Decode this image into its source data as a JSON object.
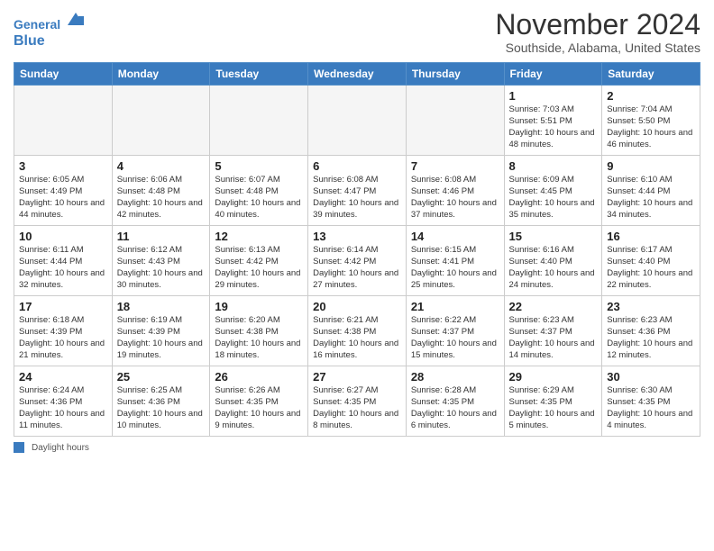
{
  "header": {
    "logo_line1": "General",
    "logo_line2": "Blue",
    "title": "November 2024",
    "subtitle": "Southside, Alabama, United States"
  },
  "days_of_week": [
    "Sunday",
    "Monday",
    "Tuesday",
    "Wednesday",
    "Thursday",
    "Friday",
    "Saturday"
  ],
  "weeks": [
    [
      {
        "day": "",
        "info": ""
      },
      {
        "day": "",
        "info": ""
      },
      {
        "day": "",
        "info": ""
      },
      {
        "day": "",
        "info": ""
      },
      {
        "day": "",
        "info": ""
      },
      {
        "day": "1",
        "info": "Sunrise: 7:03 AM\nSunset: 5:51 PM\nDaylight: 10 hours and 48 minutes."
      },
      {
        "day": "2",
        "info": "Sunrise: 7:04 AM\nSunset: 5:50 PM\nDaylight: 10 hours and 46 minutes."
      }
    ],
    [
      {
        "day": "3",
        "info": "Sunrise: 6:05 AM\nSunset: 4:49 PM\nDaylight: 10 hours and 44 minutes."
      },
      {
        "day": "4",
        "info": "Sunrise: 6:06 AM\nSunset: 4:48 PM\nDaylight: 10 hours and 42 minutes."
      },
      {
        "day": "5",
        "info": "Sunrise: 6:07 AM\nSunset: 4:48 PM\nDaylight: 10 hours and 40 minutes."
      },
      {
        "day": "6",
        "info": "Sunrise: 6:08 AM\nSunset: 4:47 PM\nDaylight: 10 hours and 39 minutes."
      },
      {
        "day": "7",
        "info": "Sunrise: 6:08 AM\nSunset: 4:46 PM\nDaylight: 10 hours and 37 minutes."
      },
      {
        "day": "8",
        "info": "Sunrise: 6:09 AM\nSunset: 4:45 PM\nDaylight: 10 hours and 35 minutes."
      },
      {
        "day": "9",
        "info": "Sunrise: 6:10 AM\nSunset: 4:44 PM\nDaylight: 10 hours and 34 minutes."
      }
    ],
    [
      {
        "day": "10",
        "info": "Sunrise: 6:11 AM\nSunset: 4:44 PM\nDaylight: 10 hours and 32 minutes."
      },
      {
        "day": "11",
        "info": "Sunrise: 6:12 AM\nSunset: 4:43 PM\nDaylight: 10 hours and 30 minutes."
      },
      {
        "day": "12",
        "info": "Sunrise: 6:13 AM\nSunset: 4:42 PM\nDaylight: 10 hours and 29 minutes."
      },
      {
        "day": "13",
        "info": "Sunrise: 6:14 AM\nSunset: 4:42 PM\nDaylight: 10 hours and 27 minutes."
      },
      {
        "day": "14",
        "info": "Sunrise: 6:15 AM\nSunset: 4:41 PM\nDaylight: 10 hours and 25 minutes."
      },
      {
        "day": "15",
        "info": "Sunrise: 6:16 AM\nSunset: 4:40 PM\nDaylight: 10 hours and 24 minutes."
      },
      {
        "day": "16",
        "info": "Sunrise: 6:17 AM\nSunset: 4:40 PM\nDaylight: 10 hours and 22 minutes."
      }
    ],
    [
      {
        "day": "17",
        "info": "Sunrise: 6:18 AM\nSunset: 4:39 PM\nDaylight: 10 hours and 21 minutes."
      },
      {
        "day": "18",
        "info": "Sunrise: 6:19 AM\nSunset: 4:39 PM\nDaylight: 10 hours and 19 minutes."
      },
      {
        "day": "19",
        "info": "Sunrise: 6:20 AM\nSunset: 4:38 PM\nDaylight: 10 hours and 18 minutes."
      },
      {
        "day": "20",
        "info": "Sunrise: 6:21 AM\nSunset: 4:38 PM\nDaylight: 10 hours and 16 minutes."
      },
      {
        "day": "21",
        "info": "Sunrise: 6:22 AM\nSunset: 4:37 PM\nDaylight: 10 hours and 15 minutes."
      },
      {
        "day": "22",
        "info": "Sunrise: 6:23 AM\nSunset: 4:37 PM\nDaylight: 10 hours and 14 minutes."
      },
      {
        "day": "23",
        "info": "Sunrise: 6:23 AM\nSunset: 4:36 PM\nDaylight: 10 hours and 12 minutes."
      }
    ],
    [
      {
        "day": "24",
        "info": "Sunrise: 6:24 AM\nSunset: 4:36 PM\nDaylight: 10 hours and 11 minutes."
      },
      {
        "day": "25",
        "info": "Sunrise: 6:25 AM\nSunset: 4:36 PM\nDaylight: 10 hours and 10 minutes."
      },
      {
        "day": "26",
        "info": "Sunrise: 6:26 AM\nSunset: 4:35 PM\nDaylight: 10 hours and 9 minutes."
      },
      {
        "day": "27",
        "info": "Sunrise: 6:27 AM\nSunset: 4:35 PM\nDaylight: 10 hours and 8 minutes."
      },
      {
        "day": "28",
        "info": "Sunrise: 6:28 AM\nSunset: 4:35 PM\nDaylight: 10 hours and 6 minutes."
      },
      {
        "day": "29",
        "info": "Sunrise: 6:29 AM\nSunset: 4:35 PM\nDaylight: 10 hours and 5 minutes."
      },
      {
        "day": "30",
        "info": "Sunrise: 6:30 AM\nSunset: 4:35 PM\nDaylight: 10 hours and 4 minutes."
      }
    ]
  ],
  "legend": {
    "box_label": "Daylight hours"
  }
}
